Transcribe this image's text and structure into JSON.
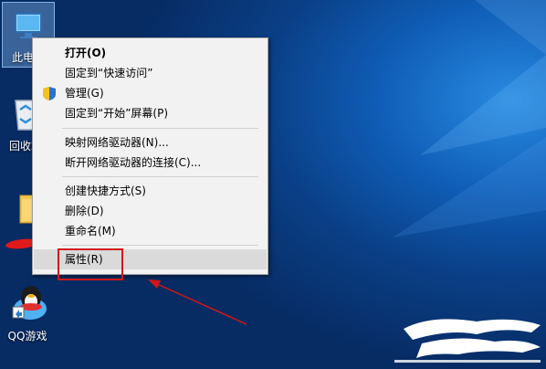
{
  "desktop": {
    "icons": [
      {
        "label": "此电脑",
        "icon": "computer-icon"
      },
      {
        "label": "回收站",
        "icon": "recycle-bin-icon"
      },
      {
        "label": "",
        "icon": "folder-icon"
      },
      {
        "label": "QQ游戏",
        "icon": "qq-game-icon"
      }
    ]
  },
  "context_menu": {
    "items": [
      {
        "label": "打开(O)",
        "bold": true
      },
      {
        "label": "固定到“快速访问”"
      },
      {
        "label": "管理(G)",
        "icon": "shield-icon"
      },
      {
        "label": "固定到“开始”屏幕(P)"
      },
      {
        "label": "映射网络驱动器(N)..."
      },
      {
        "label": "断开网络驱动器的连接(C)..."
      },
      {
        "label": "创建快捷方式(S)"
      },
      {
        "label": "删除(D)"
      },
      {
        "label": "重命名(M)"
      },
      {
        "label": "属性(R)",
        "highlighted": true
      }
    ]
  },
  "annotations": {
    "highlight_color": "#d01818",
    "highlighted_item": "属性(R)"
  }
}
